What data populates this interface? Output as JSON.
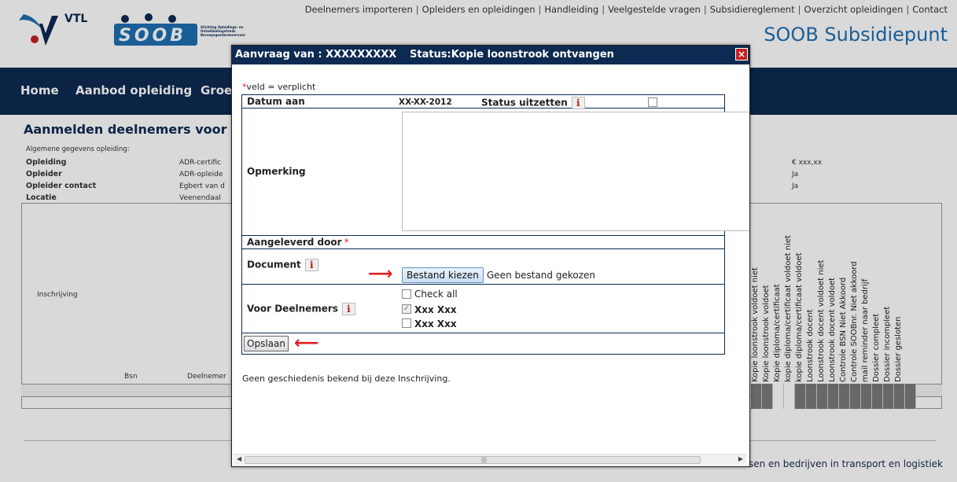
{
  "top_nav": [
    "Deelnemers importeren",
    "Opleiders en opleidingen",
    "Handleiding",
    "Veelgestelde vragen",
    "Subsidiereglement",
    "Overzicht opleidingen",
    "Contact"
  ],
  "logo": {
    "vtl": "VTL",
    "soob": "SOOB",
    "soob_sub": "Stichting Opleidings- en Ontwikkelingsfonds Beroepsgoederenvervoer"
  },
  "site_title": "SOOB Subsidiepunt",
  "main_nav": [
    "Home",
    "Aanbod opleiding",
    "Groe"
  ],
  "page_heading": "Aanmelden deelnemers voor SOO",
  "general": {
    "label": "Algemene gegevens opleiding:",
    "rows": [
      {
        "key": "Opleiding",
        "value": "ADR-certific"
      },
      {
        "key": "Opleider",
        "value": "ADR-opleide"
      },
      {
        "key": "Opleider contact",
        "value": "Egbert van d"
      },
      {
        "key": "Locatie",
        "value": "Veenendaal"
      }
    ],
    "right_values": [
      "€ xxx,xx",
      "Ja",
      "Ja"
    ]
  },
  "reg_table": {
    "inschrijving": "Inschrijving",
    "bsn": "Bsn",
    "deelnemer": "Deelnemer",
    "vertical_columns": [
      "Kopie loonstrook voldoet niet",
      "Kopie loonstrook voldoet",
      "Kopie diploma/certificaat",
      "kopie diploma/certificaat voldoet niet",
      "kopie diploma/certificaat voldoet",
      "Loonstrook docent",
      "Loonstrook docent voldoet niet",
      "Loonstrook docent voldoet",
      "Controle BSN Niet Akkoord",
      "Controle SOOBnr. Niet akkoord",
      "mail reminder naar bedrijf",
      "Dossier compleet",
      "Dossier incompleet",
      "Dossier gesloten"
    ]
  },
  "footer_text": "sen en bedrijven in transport en logistiek",
  "dialog": {
    "title_left": "Aanvraag van : XXXXXXXXX",
    "title_status": "Status:Kopie loonstrook ontvangen",
    "close": "×",
    "required_note": "veld = verplicht",
    "required_star": "*",
    "fields": {
      "datum_label": "Datum aan",
      "datum_value": "XX-XX-2012",
      "status_label": "Status uitzetten",
      "opmerking_label": "Opmerking",
      "aangeleverd_label": "Aangeleverd door",
      "document_label": "Document",
      "file_button": "Bestand kiezen",
      "file_none": "Geen bestand gekozen",
      "deelnemers_label": "Voor Deelnemers",
      "check_all": "Check all",
      "participants": [
        {
          "name": "Xxx Xxx",
          "checked": true
        },
        {
          "name": "Xxx Xxx",
          "checked": false
        }
      ],
      "save_button": "Opslaan"
    },
    "info_glyph": "i",
    "history": "Geen geschiedenis bekend bij deze Inschrijving."
  },
  "colors": {
    "navy": "#0d2a52",
    "accent_blue": "#1f6fb3",
    "red": "#e02020"
  }
}
